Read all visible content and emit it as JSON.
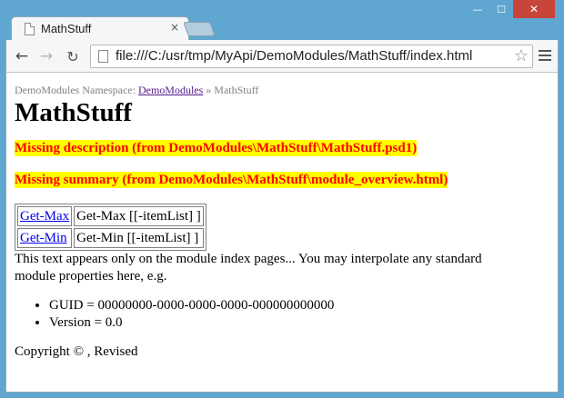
{
  "window": {
    "tab_title": "MathStuff",
    "tab_close": "×",
    "min": "—",
    "max": "☐",
    "close": "✕"
  },
  "toolbar": {
    "back": "←",
    "forward": "→",
    "reload": "↻",
    "url": "file:///C:/usr/tmp/MyApi/DemoModules/MathStuff/index.html",
    "star": "☆"
  },
  "page": {
    "breadcrumb": {
      "prefix": "DemoModules Namespace: ",
      "link": "DemoModules",
      "separator": " » ",
      "current": "MathStuff"
    },
    "title": "MathStuff",
    "missing_description": "Missing description (from DemoModules\\MathStuff\\MathStuff.psd1)",
    "missing_summary": "Missing summary (from DemoModules\\MathStuff\\module_overview.html)",
    "commands": [
      {
        "link": "Get-Max",
        "syntax": "Get-Max [[-itemList] ]"
      },
      {
        "link": "Get-Min",
        "syntax": "Get-Min [[-itemList] ]"
      }
    ],
    "paragraph": "This text appears only on the module index pages... You may interpolate any standard module properties here, e.g.",
    "properties": [
      "GUID = 00000000-0000-0000-0000-000000000000",
      "Version = 0.0"
    ],
    "copyright": "Copyright © , Revised"
  }
}
